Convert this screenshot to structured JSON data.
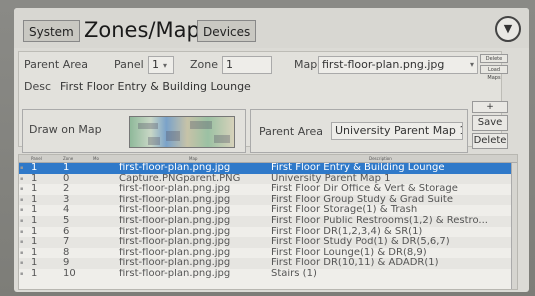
{
  "header": {
    "tab_system": "System",
    "title": "Zones/Maps",
    "tab_devices": "Devices",
    "menu_icon": "▼"
  },
  "form": {
    "parent_area_label": "Parent Area",
    "panel_label": "Panel",
    "panel_value": "1",
    "zone_label": "Zone",
    "zone_value": "1",
    "map_label": "Map",
    "map_value": "first-floor-plan.png.jpg",
    "delete_map_label": "Delete",
    "load_maps_label": "Load Maps",
    "desc_label": "Desc",
    "desc_value": "First Floor Entry & Building Lounge",
    "draw_on_map_label": "Draw on Map",
    "parent_area2_label": "Parent Area",
    "parent_area_value": "University Parent Map 1",
    "add_label": "+",
    "save_label": "Save",
    "delete_label": "Delete"
  },
  "table": {
    "columns": [
      "Panel",
      "Zone",
      "Mo",
      "Map",
      "Description"
    ],
    "rows": [
      {
        "panel": "1",
        "zone": "1",
        "map": "first-floor-plan.png.jpg",
        "desc": "First Floor Entry & Building Lounge",
        "selected": true
      },
      {
        "panel": "1",
        "zone": "0",
        "map": "Capture.PNGparent.PNG",
        "desc": "University Parent Map 1"
      },
      {
        "panel": "1",
        "zone": "2",
        "map": "first-floor-plan.png.jpg",
        "desc": "First Floor Dir Office & Vert & Storage"
      },
      {
        "panel": "1",
        "zone": "3",
        "map": "first-floor-plan.png.jpg",
        "desc": "First Floor Group Study & Grad Suite"
      },
      {
        "panel": "1",
        "zone": "4",
        "map": "first-floor-plan.png.jpg",
        "desc": "First Floor Storage(1) & Trash"
      },
      {
        "panel": "1",
        "zone": "5",
        "map": "first-floor-plan.png.jpg",
        "desc": "First Floor Public Restrooms(1,2) & Restro..."
      },
      {
        "panel": "1",
        "zone": "6",
        "map": "first-floor-plan.png.jpg",
        "desc": "First Floor DR(1,2,3,4) & SR(1)"
      },
      {
        "panel": "1",
        "zone": "7",
        "map": "first-floor-plan.png.jpg",
        "desc": "First Floor Study Pod(1) & DR(5,6,7)"
      },
      {
        "panel": "1",
        "zone": "8",
        "map": "first-floor-plan.png.jpg",
        "desc": "First Floor Lounge(1) & DR(8,9)"
      },
      {
        "panel": "1",
        "zone": "9",
        "map": "first-floor-plan.png.jpg",
        "desc": "First Floor DR(10,11) & ADADR(1)"
      },
      {
        "panel": "1",
        "zone": "10",
        "map": "first-floor-plan.png.jpg",
        "desc": "Stairs (1)"
      }
    ]
  }
}
